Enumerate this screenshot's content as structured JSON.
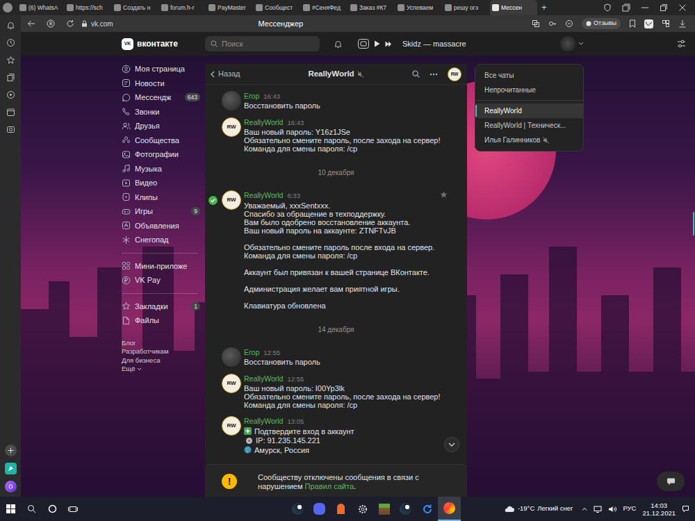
{
  "browser": {
    "tabs": [
      {
        "label": "(6) WhatsA",
        "selected": false
      },
      {
        "label": "https://sch",
        "selected": false
      },
      {
        "label": "Создать н",
        "selected": false
      },
      {
        "label": "forum.h-r",
        "selected": false
      },
      {
        "label": "PayMaster",
        "selected": false
      },
      {
        "label": "Сообщест",
        "selected": false
      },
      {
        "label": "#СеняФед",
        "selected": false
      },
      {
        "label": "Заказ #К7",
        "selected": false
      },
      {
        "label": "Успеваем",
        "selected": false
      },
      {
        "label": "решу огэ",
        "selected": false
      },
      {
        "label": "Мессен",
        "selected": true
      }
    ],
    "new_tab": "+",
    "url": "vk.com",
    "page_title": "Мессенджер",
    "feedback": "Отзывы"
  },
  "vk_header": {
    "logo_mark": "VK",
    "logo_text": "вконтакте",
    "search": {
      "placeholder": "Поиск"
    },
    "now_playing": "Skidz — massacre"
  },
  "menu": {
    "groups": [
      [
        {
          "label": "Моя страница"
        },
        {
          "label": "Новости"
        },
        {
          "label": "Мессендж",
          "badge": "643"
        },
        {
          "label": "Звонки"
        },
        {
          "label": "Друзья"
        },
        {
          "label": "Сообщества"
        },
        {
          "label": "Фотографии"
        },
        {
          "label": "Музыка"
        },
        {
          "label": "Видео"
        },
        {
          "label": "Клипы"
        },
        {
          "label": "Игры",
          "badge": "9"
        },
        {
          "label": "Объявления"
        },
        {
          "label": "Снегопад"
        }
      ],
      [
        {
          "label": "Мини-приложе"
        },
        {
          "label": "VK Pay"
        }
      ],
      [
        {
          "label": "Закладки",
          "badge": "1"
        },
        {
          "label": "Файлы"
        }
      ]
    ],
    "footer": [
      "Блог",
      "Разработчикам",
      "Для бизнеса",
      "Ещё"
    ]
  },
  "chat": {
    "back": "Назад",
    "title": "ReallyWorld",
    "muted": true,
    "avatar": {
      "label": "RW"
    },
    "messages": [
      {
        "kind": "message",
        "author": "Егор",
        "time": "16:43",
        "avatar": {
          "kind": "photo"
        },
        "selected": false,
        "lines": [
          "Восстановить пароль"
        ]
      },
      {
        "kind": "message",
        "author": "ReallyWorld",
        "time": "16:43",
        "avatar": {
          "kind": "logo",
          "label": "RW"
        },
        "selected": false,
        "lines": [
          "Ваш новый пароль: Y16z1JSe",
          "Обязательно смените пароль, после захода на сервер!",
          "Команда для смены пароля: /cp"
        ]
      },
      {
        "kind": "date",
        "text": "10 декабря"
      },
      {
        "kind": "message",
        "author": "ReallyWorld",
        "time": "6:33",
        "avatar": {
          "kind": "logo",
          "label": "RW"
        },
        "selected": true,
        "lines": [
          "Уважаемый, xxxSentxxx.",
          "Спасибо за обращение в техподдержку.",
          "Вам было одобрено восстановление аккаунта.",
          "Ваш новый пароль на аккаунте: ZTNFTvJB",
          "",
          "Обязательно смените пароль после входа на сервер.",
          "Команда для смены пароля: /cp",
          "",
          "Аккаунт был привязан к вашей странице ВКонтакте.",
          "",
          "Администрация желает вам приятной игры.",
          "",
          "Клавиатура обновлена"
        ]
      },
      {
        "kind": "date",
        "text": "14 декабря"
      },
      {
        "kind": "message",
        "author": "Егор",
        "time": "12:55",
        "avatar": {
          "kind": "photo"
        },
        "selected": false,
        "lines": [
          "Восстановить пароль"
        ]
      },
      {
        "kind": "message",
        "author": "ReallyWorld",
        "time": "12:55",
        "avatar": {
          "kind": "logo",
          "label": "RW"
        },
        "selected": false,
        "lines": [
          "Ваш новый пароль: I00Yp3lk",
          "Обязательно смените пароль, после захода на сервер!",
          "Команда для смены пароля: /cp"
        ]
      },
      {
        "kind": "message",
        "author": "ReallyWorld",
        "time": "13:05",
        "avatar": {
          "kind": "logo",
          "label": "RW"
        },
        "selected": false,
        "lines": [
          {
            "kind": "confirm",
            "text": "Подтвердите вход в аккаунт"
          },
          {
            "kind": "ip",
            "text": "IP: 91.235.145.221"
          },
          {
            "kind": "location",
            "text": "Амурск, Россия"
          }
        ]
      }
    ],
    "notice": {
      "icon": "!",
      "text": "Сообществу отключены сообщения в связи с нарушением ",
      "link": "Правил сайта",
      "end": "."
    }
  },
  "chat_filter": {
    "items": [
      {
        "label": "Все чаты",
        "kind": "filter",
        "selected": false
      },
      {
        "label": "Непрочитанные",
        "kind": "filter",
        "selected": false
      },
      {
        "label": "ReallyWorld",
        "kind": "chat",
        "selected": true,
        "muted": false
      },
      {
        "label": "ReallyWorld | Техническ...",
        "kind": "chat",
        "selected": false,
        "muted": false
      },
      {
        "label": "Илья Галинников",
        "kind": "chat",
        "selected": false,
        "muted": true
      }
    ]
  },
  "taskbar": {
    "temperature": "-19°C",
    "weather": "Легкий снег",
    "language": "РУС",
    "time": "14:03",
    "date": "21.12.2021"
  }
}
